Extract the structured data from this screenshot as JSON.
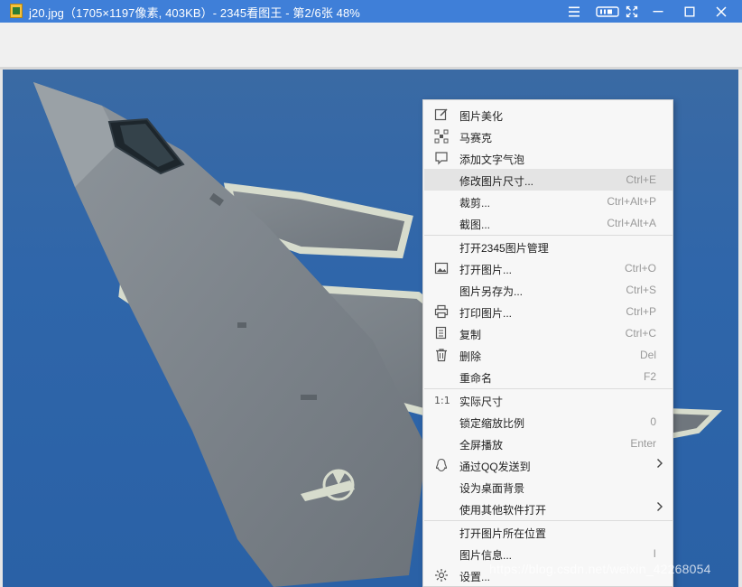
{
  "window": {
    "title": "j20.jpg（1705×1197像素, 403KB）- 2345看图王 - 第2/6张 48%",
    "controls": [
      "menu-icon",
      "mini-mode-icon",
      "fullscreen-icon",
      "minimize-icon",
      "maximize-icon",
      "close-icon"
    ]
  },
  "context_menu": {
    "items": [
      {
        "label": "图片美化",
        "shortcut": "",
        "icon": "edit-icon"
      },
      {
        "label": "马赛克",
        "shortcut": "",
        "icon": "mosaic-icon"
      },
      {
        "label": "添加文字气泡",
        "shortcut": "",
        "icon": "text-bubble-icon"
      },
      {
        "label": "修改图片尺寸...",
        "shortcut": "Ctrl+E",
        "icon": ""
      },
      {
        "label": "裁剪...",
        "shortcut": "Ctrl+Alt+P",
        "icon": ""
      },
      {
        "label": "截图...",
        "shortcut": "Ctrl+Alt+A",
        "icon": ""
      },
      {
        "label": "打开2345图片管理",
        "shortcut": "",
        "icon": ""
      },
      {
        "label": "打开图片...",
        "shortcut": "Ctrl+O",
        "icon": "image-icon"
      },
      {
        "label": "图片另存为...",
        "shortcut": "Ctrl+S",
        "icon": ""
      },
      {
        "label": "打印图片...",
        "shortcut": "Ctrl+P",
        "icon": "printer-icon"
      },
      {
        "label": "复制",
        "shortcut": "Ctrl+C",
        "icon": "copy-icon"
      },
      {
        "label": "删除",
        "shortcut": "Del",
        "icon": "trash-icon"
      },
      {
        "label": "重命名",
        "shortcut": "F2",
        "icon": ""
      },
      {
        "label": "实际尺寸",
        "shortcut": "",
        "icon": "actual-size-icon"
      },
      {
        "label": "锁定缩放比例",
        "shortcut": "0",
        "icon": ""
      },
      {
        "label": "全屏播放",
        "shortcut": "Enter",
        "icon": ""
      },
      {
        "label": "通过QQ发送到",
        "shortcut": "",
        "icon": "qq-icon",
        "submenu": true
      },
      {
        "label": "设为桌面背景",
        "shortcut": "",
        "icon": ""
      },
      {
        "label": "使用其他软件打开",
        "shortcut": "",
        "icon": "",
        "submenu": true
      },
      {
        "label": "打开图片所在位置",
        "shortcut": "",
        "icon": ""
      },
      {
        "label": "图片信息...",
        "shortcut": "I",
        "icon": ""
      },
      {
        "label": "设置...",
        "shortcut": "",
        "icon": "gear-icon"
      }
    ],
    "highlighted_index": 3
  },
  "watermark": "https://blog.csdn.net/weixin_42268054",
  "colors": {
    "titlebar": "#3f7fd8",
    "sky": "#2f66aa",
    "menu_bg": "#f7f7f7",
    "menu_highlight": "#e4e4e4"
  }
}
